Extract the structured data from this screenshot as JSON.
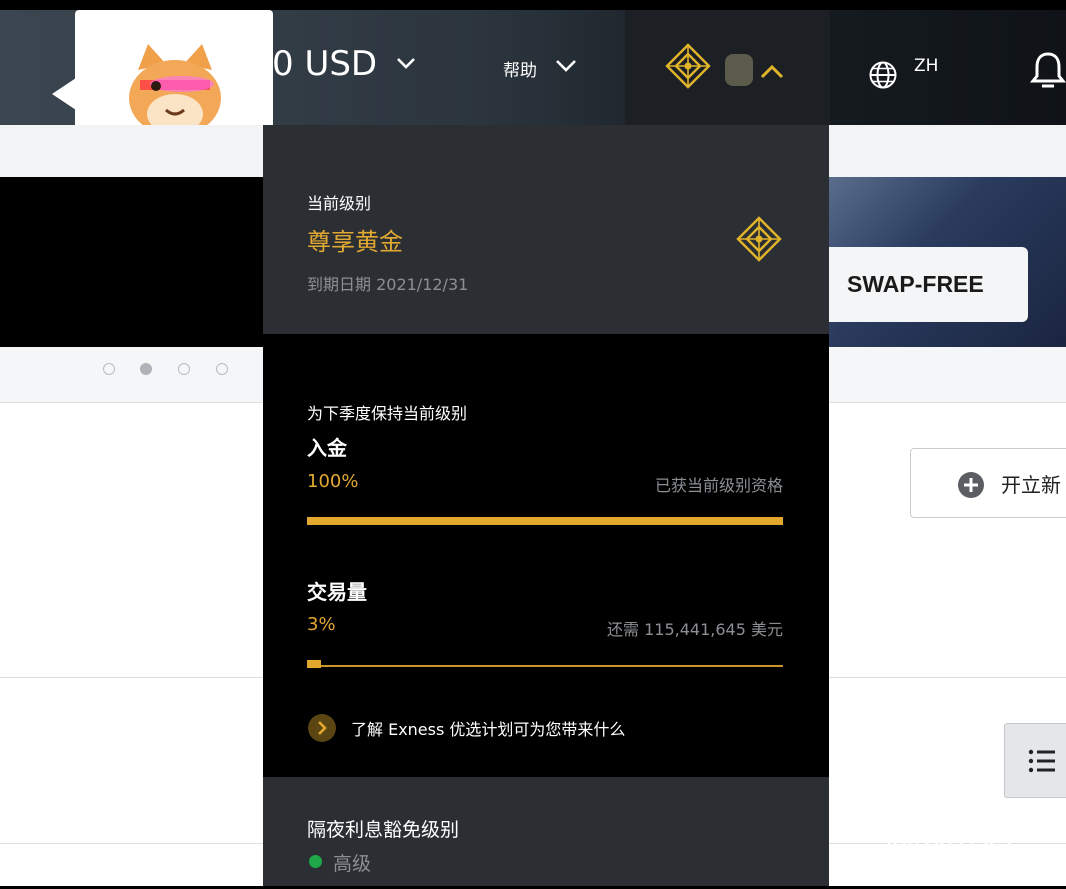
{
  "header": {
    "balance_label": "0 USD",
    "help_label": "帮助",
    "language_label": "ZH"
  },
  "banner": {
    "swap_free_label": "SWAP-FREE",
    "carousel": {
      "count": 4,
      "active_index": 1
    }
  },
  "main": {
    "open_new_label": "开立新"
  },
  "tier_panel": {
    "current_level_caption": "当前级别",
    "current_level_name": "尊享黄金",
    "expiry_text": "到期日期 2021/12/31",
    "maintain_caption": "为下季度保持当前级别",
    "deposit": {
      "title": "入金",
      "percent_label": "100%",
      "percent_value": 100,
      "status_text": "已获当前级别资格"
    },
    "volume": {
      "title": "交易量",
      "percent_label": "3%",
      "percent_value": 3,
      "status_text": "还需 115,441,645 美元"
    },
    "learn_more_text": "了解 Exness 优选计划可为您带来什么",
    "swap_level_caption": "隔夜利息豁免级别",
    "swap_level_value": "高级"
  },
  "watermark": "@940142",
  "colors": {
    "gold": "#e1a832",
    "panel_dark": "#2b2f34",
    "status_green": "#1fa84a"
  },
  "icons": [
    "chevron-down-icon",
    "diamond-tier-icon",
    "chevron-up-icon",
    "globe-icon",
    "bell-icon",
    "plus-circle-icon",
    "list-icon",
    "chevron-right-icon"
  ]
}
